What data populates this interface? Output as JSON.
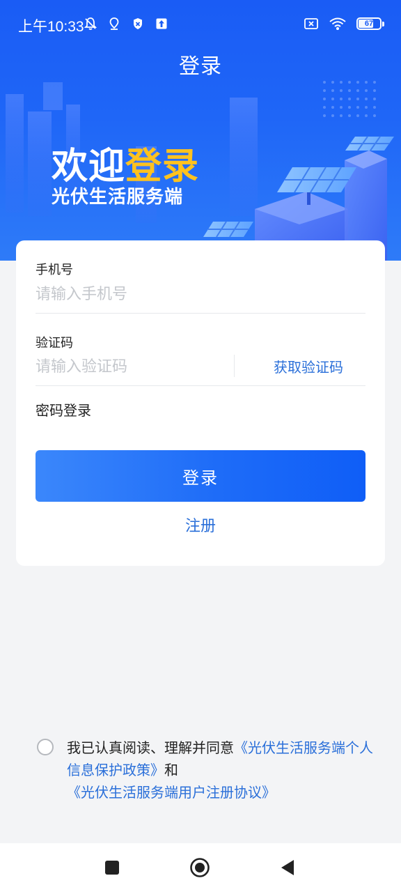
{
  "status_bar": {
    "time": "上午10:33",
    "battery_level": "67"
  },
  "header": {
    "title": "登录"
  },
  "hero": {
    "welcome_plain": "欢迎",
    "welcome_accent": "登录",
    "subtitle": "光伏生活服务端"
  },
  "form": {
    "phone_label": "手机号",
    "phone_placeholder": "请输入手机号",
    "code_label": "验证码",
    "code_placeholder": "请输入验证码",
    "get_code_label": "获取验证码",
    "password_login_label": "密码登录",
    "login_button_label": "登录",
    "register_label": "注册"
  },
  "agreement": {
    "prefix": "我已认真阅读、理解并同意",
    "privacy_link": "《光伏生活服务端个人信息保护政策》",
    "conjunction": "和",
    "terms_link": "《光伏生活服务端用户注册协议》"
  },
  "colors": {
    "primary": "#1f66f7",
    "accent_yellow": "#ffc21f",
    "link": "#2a6fd9",
    "background": "#f3f4f6"
  },
  "icons": {
    "status_left": [
      "mute-icon",
      "location-icon",
      "shield-icon",
      "upload-icon"
    ],
    "status_right": [
      "no-sim-icon",
      "wifi-icon",
      "battery-icon"
    ],
    "nav": [
      "recent-apps-icon",
      "home-icon",
      "back-icon"
    ]
  }
}
